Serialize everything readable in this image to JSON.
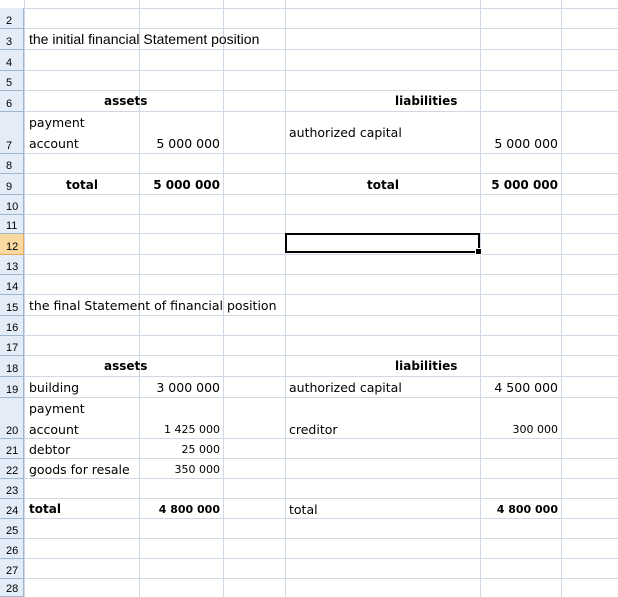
{
  "rows": [
    "2",
    "3",
    "4",
    "5",
    "6",
    "7",
    "8",
    "9",
    "10",
    "11",
    "12",
    "13",
    "14",
    "15",
    "16",
    "17",
    "18",
    "19",
    "20",
    "21",
    "22",
    "23",
    "24",
    "25",
    "26",
    "27",
    "28"
  ],
  "active_row": "12",
  "initial": {
    "title": "the initial financial Statement position",
    "assets_header": "assets",
    "liabilities_header": "liabilities",
    "payment_line1": "payment",
    "payment_line2": "account",
    "payment_value": "5 000 000",
    "authorized_capital": "authorized capital",
    "authorized_value": "5 000 000",
    "total_label": "total",
    "total_assets": "5 000 000",
    "total_liab_label": "total",
    "total_liab": "5 000 000"
  },
  "final": {
    "title": "the final Statement of financial position",
    "assets_header": "assets",
    "liabilities_header": "liabilities",
    "building": "building",
    "building_value": "3 000 000",
    "authorized_capital": "authorized capital",
    "authorized_value": "4 500 000",
    "payment_line1": "payment",
    "payment_line2": "account",
    "payment_value": "1 425 000",
    "creditor": "creditor",
    "creditor_value": "300 000",
    "debtor": "debtor",
    "debtor_value": "25 000",
    "goods": "goods for resale",
    "goods_value": "350 000",
    "total_label": "total",
    "total_assets": "4 800 000",
    "total_liab_label": "total",
    "total_liab": "4 800 000"
  }
}
